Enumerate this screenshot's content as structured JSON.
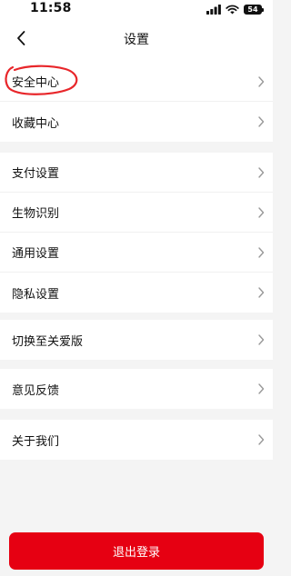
{
  "status_bar": {
    "time": "11:58",
    "battery": "54"
  },
  "nav": {
    "title": "设置"
  },
  "groups": [
    {
      "items": [
        {
          "label": "安全中心"
        },
        {
          "label": "收藏中心"
        }
      ]
    },
    {
      "items": [
        {
          "label": "支付设置"
        },
        {
          "label": "生物识别"
        },
        {
          "label": "通用设置"
        },
        {
          "label": "隐私设置"
        }
      ]
    },
    {
      "items": [
        {
          "label": "切换至关爱版"
        }
      ]
    },
    {
      "items": [
        {
          "label": "意见反馈"
        }
      ]
    },
    {
      "items": [
        {
          "label": "关于我们"
        }
      ]
    }
  ],
  "logout": {
    "label": "退出登录"
  },
  "colors": {
    "accent": "#e60012",
    "annotation": "#e8262a"
  }
}
